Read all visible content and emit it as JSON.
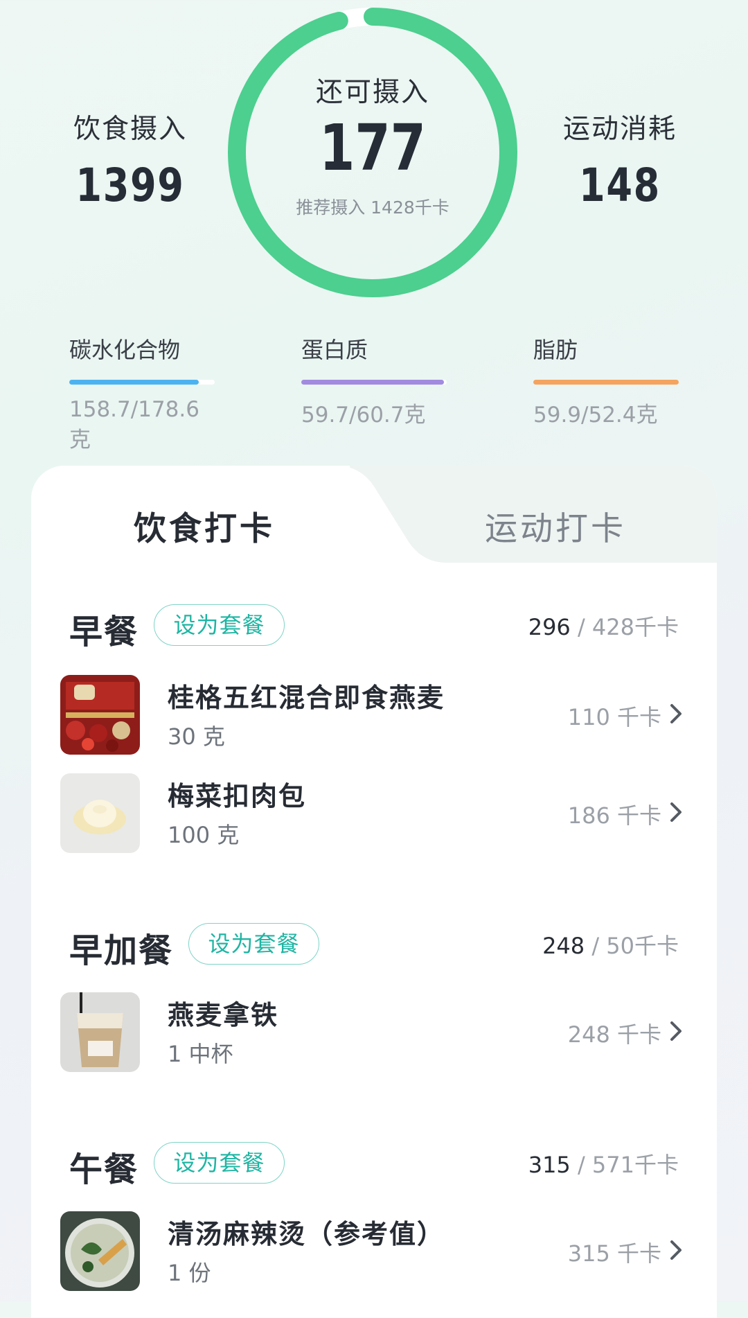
{
  "summary": {
    "diet_intake_label": "饮食摄入",
    "diet_intake_value": "1399",
    "remaining_label": "还可摄入",
    "remaining_value": "177",
    "recommended_text": "推荐摄入 1428千卡",
    "exercise_label": "运动消耗",
    "exercise_value": "148",
    "ring_progress": 0.96,
    "ring_color": "#4ccf8f",
    "ring_track_color": "#ffffff"
  },
  "macros": [
    {
      "label": "碳水化合物",
      "value": "158.7/178.6克",
      "fraction": 0.89,
      "color": "#4db3f0"
    },
    {
      "label": "蛋白质",
      "value": "59.7/60.7克",
      "fraction": 0.98,
      "color": "#a28ae0"
    },
    {
      "label": "脂肪",
      "value": "59.9/52.4克",
      "fraction": 1.0,
      "color": "#f5a35e"
    }
  ],
  "tabs": [
    {
      "label": "饮食打卡",
      "active": true
    },
    {
      "label": "运动打卡",
      "active": false
    }
  ],
  "combo_label": "设为套餐",
  "meals": [
    {
      "title": "早餐",
      "eaten": "296",
      "target": "428千卡",
      "foods": [
        {
          "name": "桂格五红混合即食燕麦",
          "qty": "30 克",
          "kcal": "110 千卡",
          "icon": "oatmeal-package-image"
        },
        {
          "name": "梅菜扣肉包",
          "qty": "100 克",
          "kcal": "186 千卡",
          "icon": "steamed-bun-image"
        }
      ]
    },
    {
      "title": "早加餐",
      "eaten": "248",
      "target": "50千卡",
      "foods": [
        {
          "name": "燕麦拿铁",
          "qty": "1 中杯",
          "kcal": "248 千卡",
          "icon": "latte-cup-image"
        }
      ]
    },
    {
      "title": "午餐",
      "eaten": "315",
      "target": "571千卡",
      "foods": [
        {
          "name": "清汤麻辣烫（参考值）",
          "qty": "1 份",
          "kcal": "315 千卡",
          "icon": "malatang-bowl-image"
        }
      ]
    }
  ]
}
